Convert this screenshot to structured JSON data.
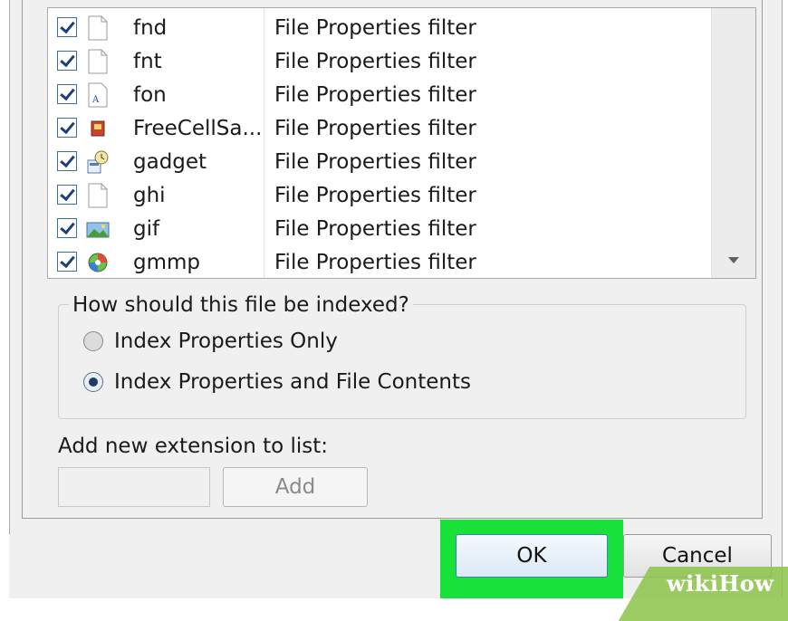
{
  "file_types": [
    {
      "icon": "blank-file-icon",
      "name": "fnd",
      "filter": "File Properties filter"
    },
    {
      "icon": "blank-file-icon",
      "name": "fnt",
      "filter": "File Properties filter"
    },
    {
      "icon": "font-file-icon",
      "name": "fon",
      "filter": "File Properties filter"
    },
    {
      "icon": "freecell-save-icon",
      "name": "FreeCellSa...",
      "filter": "File Properties filter"
    },
    {
      "icon": "gadget-icon",
      "name": "gadget",
      "filter": "File Properties filter"
    },
    {
      "icon": "blank-file-icon",
      "name": "ghi",
      "filter": "File Properties filter"
    },
    {
      "icon": "image-file-icon",
      "name": "gif",
      "filter": "File Properties filter"
    },
    {
      "icon": "media-file-icon",
      "name": "gmmp",
      "filter": "File Properties filter"
    }
  ],
  "indexing": {
    "question": "How should this file be indexed?",
    "options": [
      {
        "label": "Index Properties Only",
        "selected": false
      },
      {
        "label": "Index Properties and File Contents",
        "selected": true
      }
    ]
  },
  "add_extension": {
    "label": "Add new extension to list:",
    "input_value": "",
    "add_label": "Add"
  },
  "buttons": {
    "ok": "OK",
    "cancel": "Cancel"
  },
  "watermark": "wikiHow",
  "colors": {
    "highlight": "#18e23a",
    "check": "#1c3f7a",
    "watermark": "#8cc34a"
  }
}
